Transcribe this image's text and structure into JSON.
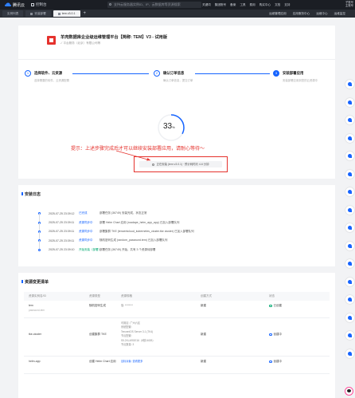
{
  "topbar": {
    "brand": "腾讯云",
    "console": "控制台",
    "search_placeholder": "支持云服务器实例ID、IP、云数据库等资源搜索",
    "nav": [
      "关键词",
      "集团账号",
      "备案",
      "工具",
      "费用",
      "购买中心",
      "文档",
      "支持"
    ],
    "user": [
      "子账号",
      "主账号"
    ]
  },
  "tabs": {
    "items": [
      "实例列表",
      "安装部署",
      "tem v3.0.1"
    ],
    "active_index": 2,
    "add": "+",
    "right": [
      "运维管理应用",
      "应用服务中心",
      "运维中心",
      "运维监控"
    ]
  },
  "header": {
    "title": "羊肉数据库企业级运维管理平台【简称: TEM】V3 - 试用版",
    "subtitle": "✓ 平台服务（北京）有限公司等"
  },
  "steps": [
    {
      "num": "1",
      "title": "选择软件、云资源",
      "desc": "选择需要的软件、云资源配置"
    },
    {
      "num": "2",
      "title": "确认订单信息",
      "desc": "确认订单信息，提交订单"
    },
    {
      "num": "3",
      "title": "安装部署应用",
      "desc": "安装部署应用到您的云资源中"
    }
  ],
  "progress": {
    "percent": "33",
    "unit": "%",
    "annotation": "提示：上述步骤完成后才可以继续安装部署应用，请耐心等待～",
    "status": "正在安装 (tem v3.0.1) · 预计耗时约 4-6 分钟"
  },
  "logs": {
    "title": "安装日志",
    "rows": [
      {
        "time": "2025-07-25 23:39:12",
        "tag": "已完成",
        "kind": "done",
        "msg": "部署任务 (36749) 安装完成，状态正常"
      },
      {
        "time": "2025-07-25 23:39:11",
        "tag": "资源同步中",
        "kind": "sync",
        "msg": "部署 Helm Chart 应用 (roadape_helm_app_app) 已加入部署队列"
      },
      {
        "time": "2025-07-25 23:39:11",
        "tag": "资源同步中",
        "kind": "sync",
        "msg": "部署集群 TKE (tencentcloud_kubernetes_cluster.tke cluster) 已加入部署队列"
      },
      {
        "time": "2025-07-25 23:39:11",
        "tag": "资源同步中",
        "kind": "sync",
        "msg": "随机密码生成 (random_password.tem) 已加入部署队列"
      },
      {
        "time": "2025-07-25 23:39:10",
        "tag": "开始安装（部署）",
        "kind": "run",
        "msg": "部署任务 (36749) 开始，共有 3 个资源待部署"
      }
    ]
  },
  "resources": {
    "title": "资源变更清单",
    "columns": [
      "资源实例名/ID",
      "资源类型",
      "资源规格",
      "创建方式",
      "状态"
    ],
    "rows": [
      {
        "name": "tem",
        "id": "password-tem",
        "type": "随机密码生成",
        "spec": [
          "值: ********"
        ],
        "method": "新建",
        "status": "已创建",
        "state": "done"
      },
      {
        "name": "tke-cluster",
        "id": "",
        "type": "创建集群 TKE",
        "spec": [
          "可用区: 广州六区",
          "系统配置:",
          "TencentOS Server 3.1 (TK4)",
          "节点配置:",
          "S5.2XLARGE16（8核16GB）",
          "节点数量: 3"
        ],
        "method": "新建",
        "status": "创建中",
        "state": "prog"
      },
      {
        "name": "helm-app",
        "id": "",
        "type": "创建 Helm Chart 应用",
        "spec": [
          "目标对象: 查看更多"
        ],
        "method": "新建",
        "status": "创建中",
        "state": "prog"
      }
    ]
  },
  "colors": {
    "accent": "#1664ff",
    "alert": "#e5322d",
    "success": "#00a870"
  }
}
